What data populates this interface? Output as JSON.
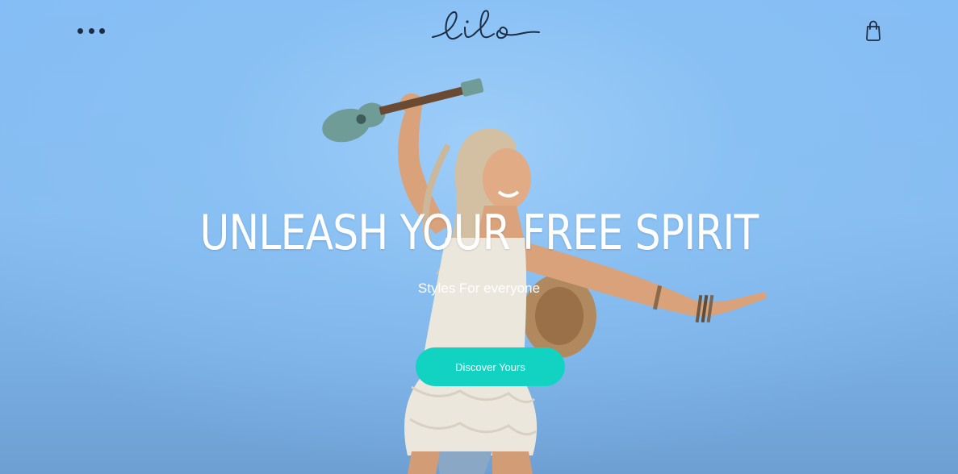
{
  "header": {
    "menu_icon": "more-dots-icon",
    "logo_text": "lilo",
    "cart_icon": "shopping-bag-icon"
  },
  "hero": {
    "headline": "UNLEASH YOUR FREE SPIRIT",
    "subheadline": "Styles For everyone",
    "cta_label": "Discover Yours",
    "background_image": "woman-jumping-with-ukulele"
  },
  "colors": {
    "sky": "#85bbef",
    "cta": "#12d3c2",
    "icon": "#1d2d44",
    "text": "#ffffff"
  }
}
